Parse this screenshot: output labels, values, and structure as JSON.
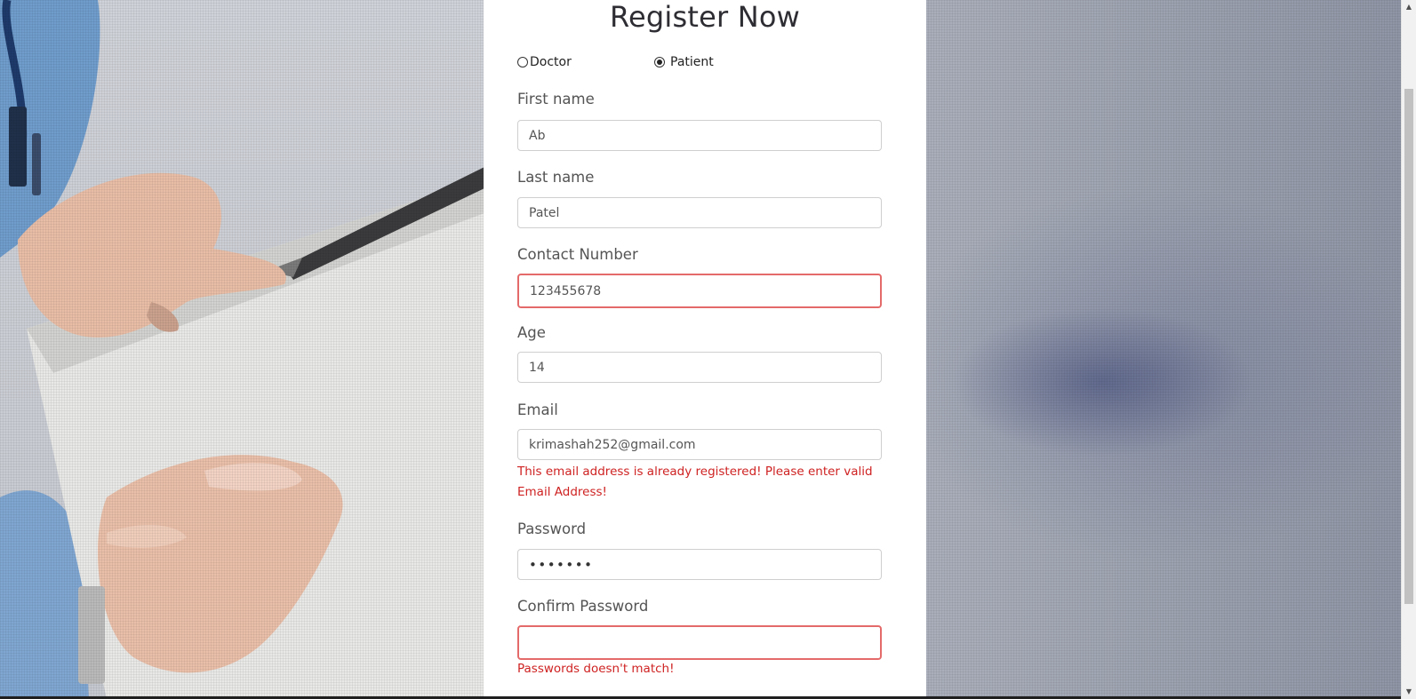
{
  "form": {
    "title": "Register Now",
    "role_options": [
      {
        "label": "Doctor",
        "checked": false
      },
      {
        "label": "Patient",
        "checked": true
      }
    ],
    "fields": {
      "first_name": {
        "label": "First name",
        "value": "Ab"
      },
      "last_name": {
        "label": "Last name",
        "value": "Patel"
      },
      "contact": {
        "label": "Contact Number",
        "value": "123455678"
      },
      "age": {
        "label": "Age",
        "value": "14"
      },
      "email": {
        "label": "Email",
        "value": "krimashah252@gmail.com",
        "error": "This email address is already registered! Please enter valid Email Address!"
      },
      "password": {
        "label": "Password",
        "value": "•••••••"
      },
      "confirm_password": {
        "label": "Confirm Password",
        "value": "",
        "error": "Passwords doesn't match!"
      }
    }
  },
  "colors": {
    "error": "#cf2222",
    "error_border": "#e46a6a"
  }
}
